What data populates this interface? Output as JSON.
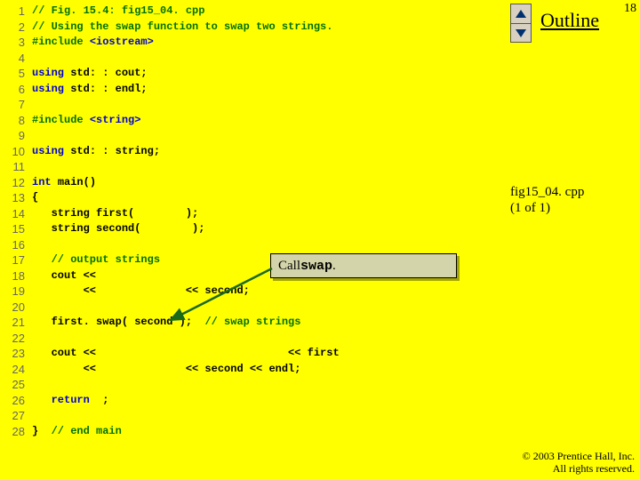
{
  "page_number": "18",
  "outline_label": "Outline",
  "fig_label_line1": "fig15_04. cpp",
  "fig_label_line2": "(1 of 1)",
  "copyright_line1": "© 2003 Prentice Hall, Inc.",
  "copyright_line2": "All rights reserved.",
  "callout_prefix": "Call ",
  "callout_code": "swap",
  "callout_suffix": ".",
  "code": {
    "l1": "// Fig. 15.4: fig15_04. cpp",
    "l2": "// Using the swap function to swap two strings.",
    "l3a": "#include ",
    "l3b": "<iostream>",
    "l5a": "using ",
    "l5b": "std: : cout;",
    "l6a": "using ",
    "l6b": "std: : endl;",
    "l8a": "#include ",
    "l8b": "<string>",
    "l10a": "using ",
    "l10b": "std: : string;",
    "l12a": "int ",
    "l12b": "main()",
    "l13": "{",
    "l14": "   string first(        );",
    "l15": "   string second(        );",
    "l17": "   // output strings",
    "l18": "   cout <<                                 ",
    "l19": "        <<              << second;",
    "l21a": "   first. swap( second );  ",
    "l21b": "// swap strings",
    "l23": "   cout <<                              << first",
    "l24": "        <<              << second << endl;",
    "l26a": "   ",
    "l26b": "return  ",
    "l26c": ";",
    "l28a": "}  ",
    "l28b": "// end main"
  },
  "linecount": 28
}
